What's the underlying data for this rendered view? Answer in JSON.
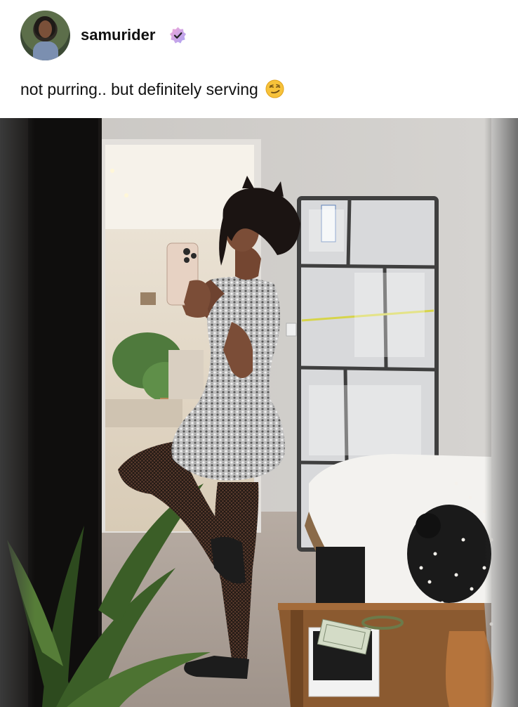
{
  "post": {
    "username": "samurider",
    "verified": true,
    "caption": "not purring.. but definitely serving",
    "caption_emoji": "smirking-face-emoji"
  },
  "colors": {
    "background": "#ffffff",
    "text": "#111111",
    "verified_badge": "#c79be8"
  }
}
